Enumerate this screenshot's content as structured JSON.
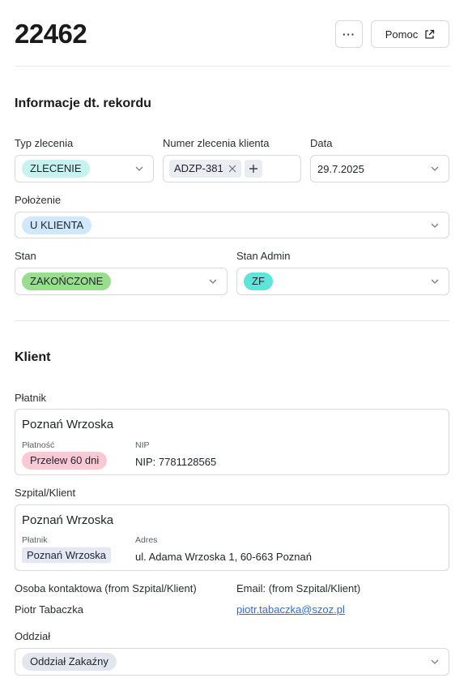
{
  "header": {
    "title": "22462",
    "more_label": "···",
    "help_label": "Pomoc"
  },
  "record_section": {
    "title": "Informacje dt. rekordu",
    "typ_zlecenia": {
      "label": "Typ zlecenia",
      "value": "ZLECENIE"
    },
    "numer_zlecenia": {
      "label": "Numer zlecenia klienta",
      "tag": "ADZP-381"
    },
    "data": {
      "label": "Data",
      "value": "29.7.2025"
    },
    "polozenie": {
      "label": "Położenie",
      "value": "U KLIENTA"
    },
    "stan": {
      "label": "Stan",
      "value": "ZAKOŃCZONE"
    },
    "stan_admin": {
      "label": "Stan Admin",
      "value": "ZF"
    }
  },
  "client_section": {
    "title": "Klient",
    "platnik": {
      "label": "Płatnik",
      "name": "Poznań Wrzoska",
      "platnosc_label": "Płatność",
      "platnosc_value": "Przelew 60 dni",
      "nip_label": "NIP",
      "nip_value": "NIP: 7781128565"
    },
    "szpital": {
      "label": "Szpital/Klient",
      "name": "Poznań Wrzoska",
      "platnik_label": "Płatnik",
      "platnik_value": "Poznań Wrzoska",
      "adres_label": "Adres",
      "adres_value": "ul. Adama Wrzoska 1, 60-663 Poznań"
    },
    "osoba": {
      "label": "Osoba kontaktowa (from Szpital/Klient)",
      "value": "Piotr Tabaczka"
    },
    "email": {
      "label": "Email: (from Szpital/Klient)",
      "value": "piotr.tabaczka@szoz.pl"
    },
    "oddzial": {
      "label": "Oddział",
      "value": "Oddział Zakaźny"
    }
  }
}
